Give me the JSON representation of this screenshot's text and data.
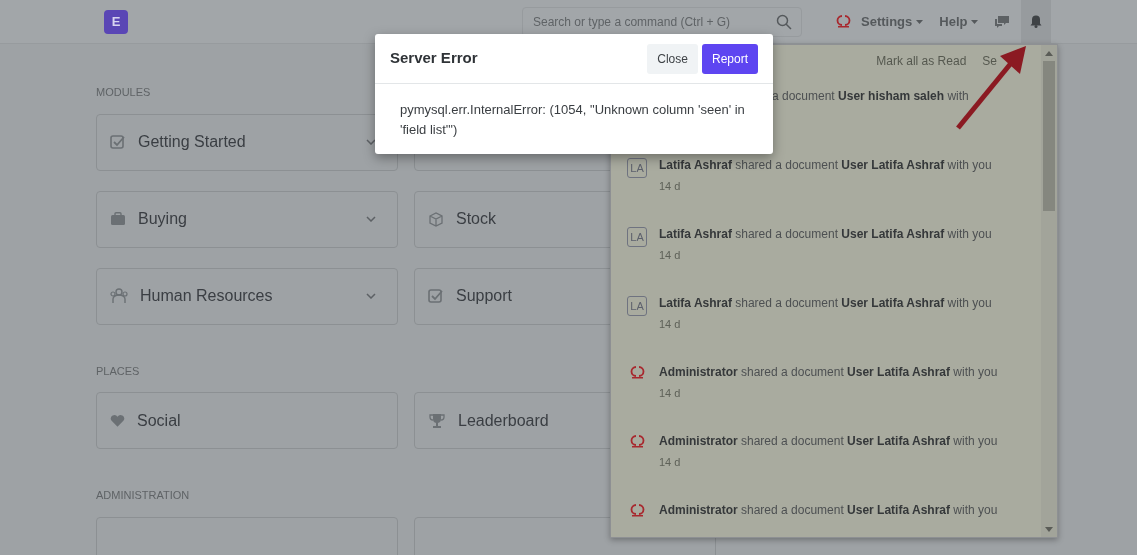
{
  "navbar": {
    "logo": "E",
    "search": {
      "placeholder": "Search or type a command (Ctrl + G)"
    },
    "menus": [
      {
        "label": "Settings"
      },
      {
        "label": "Help"
      }
    ],
    "notifications_open": true
  },
  "sections": [
    {
      "title": "MODULES",
      "cards": [
        {
          "label": "Getting Started",
          "kind": "check",
          "dropdown": true
        },
        {
          "kind": "blank",
          "dropdown": false
        },
        {
          "label": "Buying",
          "kind": "briefcase",
          "dropdown": true
        },
        {
          "label": "Stock",
          "kind": "box",
          "dropdown": false
        },
        {
          "label": "Human Resources",
          "kind": "people",
          "dropdown": true
        },
        {
          "label": "Support",
          "kind": "check",
          "dropdown": false
        }
      ]
    },
    {
      "title": "PLACES",
      "cards": [
        {
          "label": "Social",
          "kind": "heart",
          "dropdown": false
        },
        {
          "label": "Leaderboard",
          "kind": "trophy",
          "dropdown": false
        }
      ]
    },
    {
      "title": "ADMINISTRATION",
      "cards": [
        {
          "kind": "blank",
          "dropdown": false
        },
        {
          "kind": "blank",
          "dropdown": false
        }
      ]
    }
  ],
  "notifications": {
    "actions": [
      "Mark all as Read",
      "Se"
    ],
    "items": [
      {
        "kind": "partial",
        "text": "a document **User hisham saleh** with"
      },
      {
        "kind": "initials",
        "initials": "LA",
        "text": "**Latifa Ashraf** shared a document **User Latifa Ashraf** with you",
        "time": "14 d"
      },
      {
        "kind": "initials",
        "initials": "LA",
        "text": "**Latifa Ashraf** shared a document **User Latifa Ashraf** with you",
        "time": "14 d"
      },
      {
        "kind": "initials",
        "initials": "LA",
        "text": "**Latifa Ashraf** shared a document **User Latifa Ashraf** with you",
        "time": "14 d"
      },
      {
        "kind": "logo",
        "text": "**Administrator** shared a document **User Latifa Ashraf** with you",
        "time": "14 d"
      },
      {
        "kind": "logo",
        "text": "**Administrator** shared a document **User Latifa Ashraf** with you",
        "time": "14 d"
      },
      {
        "kind": "logo",
        "text": "**Administrator** shared a document **User Latifa Ashraf** with you"
      }
    ]
  },
  "dialog": {
    "title": "Server Error",
    "buttons": [
      {
        "label": "Close",
        "kind": "secondary"
      },
      {
        "label": "Report",
        "kind": "primary"
      }
    ],
    "message": "pymysql.err.InternalError: (1054, \"Unknown column 'seen' in 'field list'\")"
  },
  "annotation": {
    "kind": "arrow"
  }
}
